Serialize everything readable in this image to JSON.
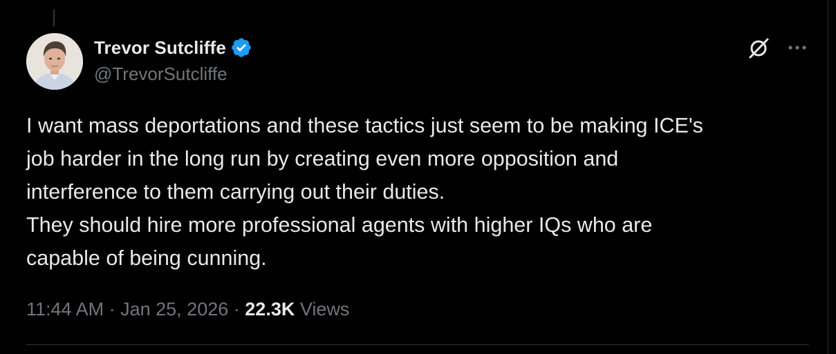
{
  "author": {
    "display_name": "Trevor Sutcliffe",
    "handle": "@TrevorSutcliffe",
    "verified": true
  },
  "tweet": {
    "lines": [
      "I want mass deportations and these tactics just seem to be making ICE's",
      "job harder in the long run by creating even more opposition and",
      "interference to them carrying out their duties.",
      "They should hire more professional agents with higher IQs who are",
      "capable of being cunning."
    ]
  },
  "meta": {
    "time": "11:44 AM",
    "separator": "·",
    "date": "Jan 25, 2026",
    "views_count": "22.3K",
    "views_label": "Views"
  },
  "icons": {
    "verified": "verified-badge-icon",
    "grok": "grok-icon",
    "more": "more-options-icon"
  },
  "colors": {
    "background": "#000000",
    "text_primary": "#e7e9ea",
    "text_secondary": "#71767b",
    "verified_blue": "#1d9bf0",
    "divider": "#2f3336"
  }
}
